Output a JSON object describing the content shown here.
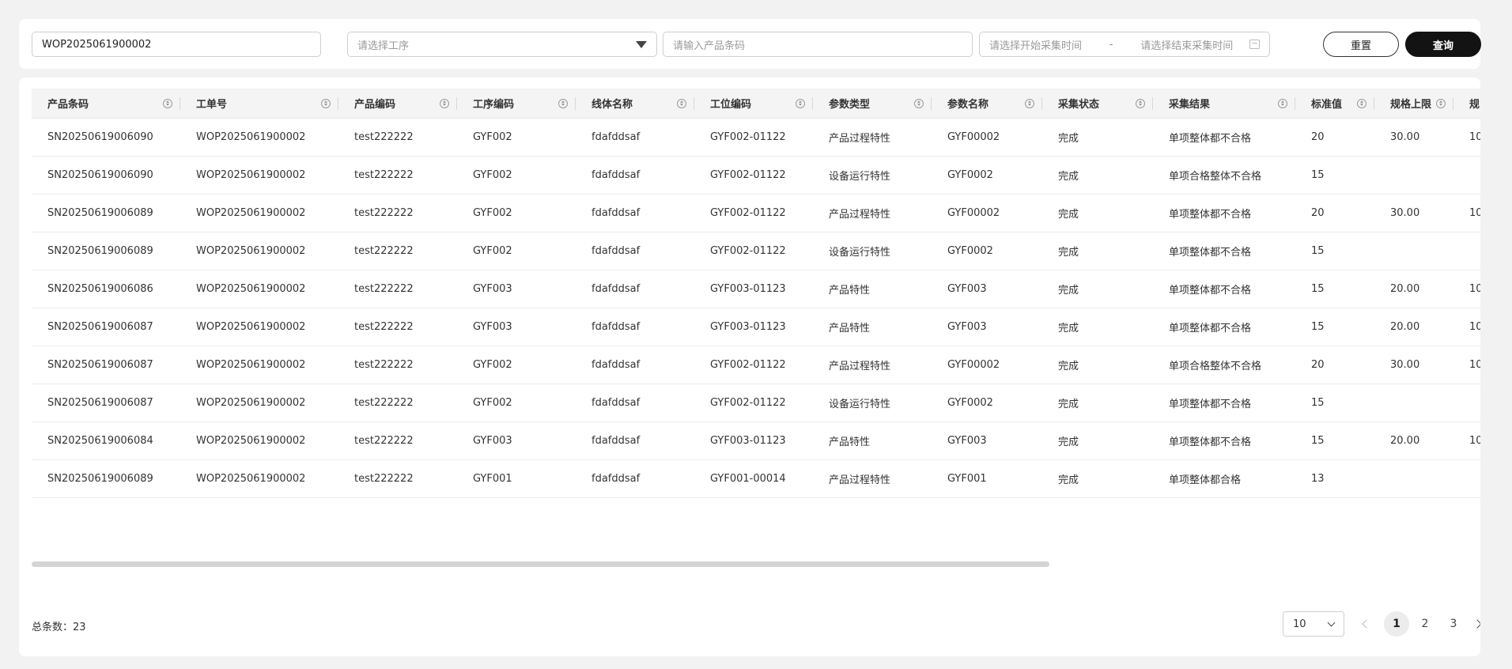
{
  "filters": {
    "work_order_value": "WOP2025061900002",
    "process_placeholder": "请选择工序",
    "barcode_placeholder": "请输入产品条码",
    "start_time_placeholder": "请选择开始采集时间",
    "range_separator": "-",
    "end_time_placeholder": "请选择结束采集时间",
    "reset_label": "重置",
    "query_label": "查询"
  },
  "table": {
    "columns": [
      "产品条码",
      "工单号",
      "产品编码",
      "工序编码",
      "线体名称",
      "工位编码",
      "参数类型",
      "参数名称",
      "采集状态",
      "采集结果",
      "标准值",
      "规格上限",
      "规"
    ],
    "rows": [
      [
        "SN20250619006090",
        "WOP2025061900002",
        "test222222",
        "GYF002",
        "fdafddsaf",
        "GYF002-01122",
        "产品过程特性",
        "GYF00002",
        "完成",
        "单项整体都不合格",
        "20",
        "30.00",
        "10"
      ],
      [
        "SN20250619006090",
        "WOP2025061900002",
        "test222222",
        "GYF002",
        "fdafddsaf",
        "GYF002-01122",
        "设备运行特性",
        "GYF0002",
        "完成",
        "单项合格整体不合格",
        "15",
        "",
        ""
      ],
      [
        "SN20250619006089",
        "WOP2025061900002",
        "test222222",
        "GYF002",
        "fdafddsaf",
        "GYF002-01122",
        "产品过程特性",
        "GYF00002",
        "完成",
        "单项整体都不合格",
        "20",
        "30.00",
        "10"
      ],
      [
        "SN20250619006089",
        "WOP2025061900002",
        "test222222",
        "GYF002",
        "fdafddsaf",
        "GYF002-01122",
        "设备运行特性",
        "GYF0002",
        "完成",
        "单项整体都不合格",
        "15",
        "",
        ""
      ],
      [
        "SN20250619006086",
        "WOP2025061900002",
        "test222222",
        "GYF003",
        "fdafddsaf",
        "GYF003-01123",
        "产品特性",
        "GYF003",
        "完成",
        "单项整体都不合格",
        "15",
        "20.00",
        "10"
      ],
      [
        "SN20250619006087",
        "WOP2025061900002",
        "test222222",
        "GYF003",
        "fdafddsaf",
        "GYF003-01123",
        "产品特性",
        "GYF003",
        "完成",
        "单项整体都不合格",
        "15",
        "20.00",
        "10"
      ],
      [
        "SN20250619006087",
        "WOP2025061900002",
        "test222222",
        "GYF002",
        "fdafddsaf",
        "GYF002-01122",
        "产品过程特性",
        "GYF00002",
        "完成",
        "单项合格整体不合格",
        "20",
        "30.00",
        "10"
      ],
      [
        "SN20250619006087",
        "WOP2025061900002",
        "test222222",
        "GYF002",
        "fdafddsaf",
        "GYF002-01122",
        "设备运行特性",
        "GYF0002",
        "完成",
        "单项整体都不合格",
        "15",
        "",
        ""
      ],
      [
        "SN20250619006084",
        "WOP2025061900002",
        "test222222",
        "GYF003",
        "fdafddsaf",
        "GYF003-01123",
        "产品特性",
        "GYF003",
        "完成",
        "单项整体都不合格",
        "15",
        "20.00",
        "10"
      ],
      [
        "SN20250619006089",
        "WOP2025061900002",
        "test222222",
        "GYF001",
        "fdafddsaf",
        "GYF001-00014",
        "产品过程特性",
        "GYF001",
        "完成",
        "单项整体都合格",
        "13",
        "",
        ""
      ]
    ]
  },
  "footer": {
    "total_label": "总条数：23",
    "page_size": "10",
    "pages": [
      "1",
      "2",
      "3"
    ],
    "current_page": "1"
  },
  "icons": {
    "sort": "sort-icon",
    "dropdown": "caret-down-icon",
    "calendar": "calendar-icon",
    "prev": "chevron-left-icon",
    "next": "chevron-right-icon"
  },
  "colors": {
    "primary_button": "#131313",
    "page_background": "#f2f2f3",
    "header_background": "#f4f4f5"
  }
}
